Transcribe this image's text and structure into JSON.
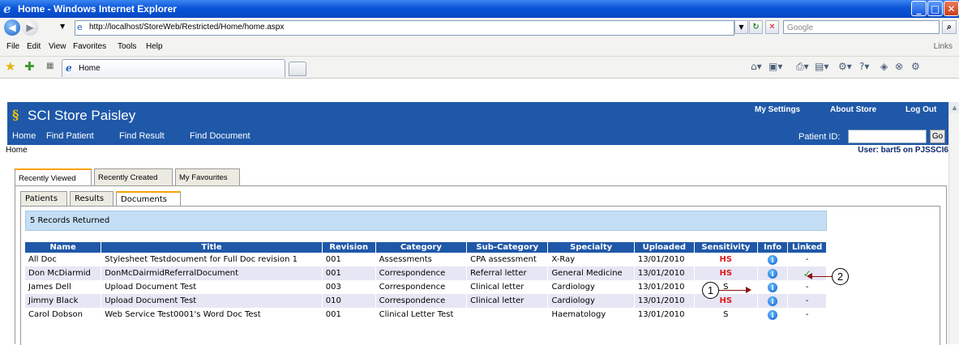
{
  "window": {
    "title": "Home - Windows Internet Explorer"
  },
  "address_bar": {
    "url": "http://localhost/StoreWeb/Restricted/Home/home.aspx",
    "search_placeholder": "Google"
  },
  "menu": {
    "items": [
      "File",
      "Edit",
      "View",
      "Favorites",
      "Tools",
      "Help"
    ],
    "links": "Links"
  },
  "browser_tab": {
    "label": "Home"
  },
  "app": {
    "name": "SCI Store Paisley",
    "top_links": [
      "My Settings",
      "About Store",
      "Log Out"
    ],
    "nav": [
      "Home",
      "Find Patient",
      "Find Result",
      "Find Document"
    ],
    "patient_id_label": "Patient ID:",
    "go_label": "Go",
    "breadcrumb": "Home",
    "user": "User: bart5 on PJSSCI6"
  },
  "outer_tabs": [
    "Recently Viewed",
    "Recently Created",
    "My Favourites"
  ],
  "inner_tabs": [
    "Patients",
    "Results",
    "Documents"
  ],
  "records_returned": "5 Records Returned",
  "table": {
    "headers": [
      "Name",
      "Title",
      "Revision",
      "Category",
      "Sub-Category",
      "Specialty",
      "Uploaded",
      "Sensitivity",
      "Info",
      "Linked"
    ],
    "rows": [
      {
        "name": "All Doc",
        "title": "Stylesheet Testdocument for Full Doc revision 1",
        "revision": "001",
        "category": "Assessments",
        "subcategory": "CPA assessment",
        "specialty": "X-Ray",
        "uploaded": "13/01/2010",
        "sensitivity": "HS",
        "linked": "-"
      },
      {
        "name": "Don McDiarmid",
        "title": "DonMcDairmidReferralDocument",
        "revision": "001",
        "category": "Correspondence",
        "subcategory": "Referral letter",
        "specialty": "General Medicine",
        "uploaded": "13/01/2010",
        "sensitivity": "HS",
        "linked": "✓"
      },
      {
        "name": "James Dell",
        "title": "Upload Document Test",
        "revision": "003",
        "category": "Correspondence",
        "subcategory": "Clinical letter",
        "specialty": "Cardiology",
        "uploaded": "13/01/2010",
        "sensitivity": "S",
        "linked": "-"
      },
      {
        "name": "Jimmy Black",
        "title": "Upload Document Test",
        "revision": "010",
        "category": "Correspondence",
        "subcategory": "Clinical letter",
        "specialty": "Cardiology",
        "uploaded": "13/01/2010",
        "sensitivity": "HS",
        "linked": "-"
      },
      {
        "name": "Carol Dobson",
        "title": "Web Service Test0001's Word Doc Test",
        "revision": "001",
        "category": "Clinical Letter Test",
        "subcategory": "",
        "specialty": "Haematology",
        "uploaded": "13/01/2010",
        "sensitivity": "S",
        "linked": "-"
      }
    ]
  },
  "callouts": [
    "1",
    "2"
  ],
  "colors": {
    "header_blue": "#1f58a8",
    "tab_accent": "#f7a10a",
    "hs_red": "#e0191b",
    "check_green": "#2f9b2f",
    "records_bg": "#c4def5"
  }
}
